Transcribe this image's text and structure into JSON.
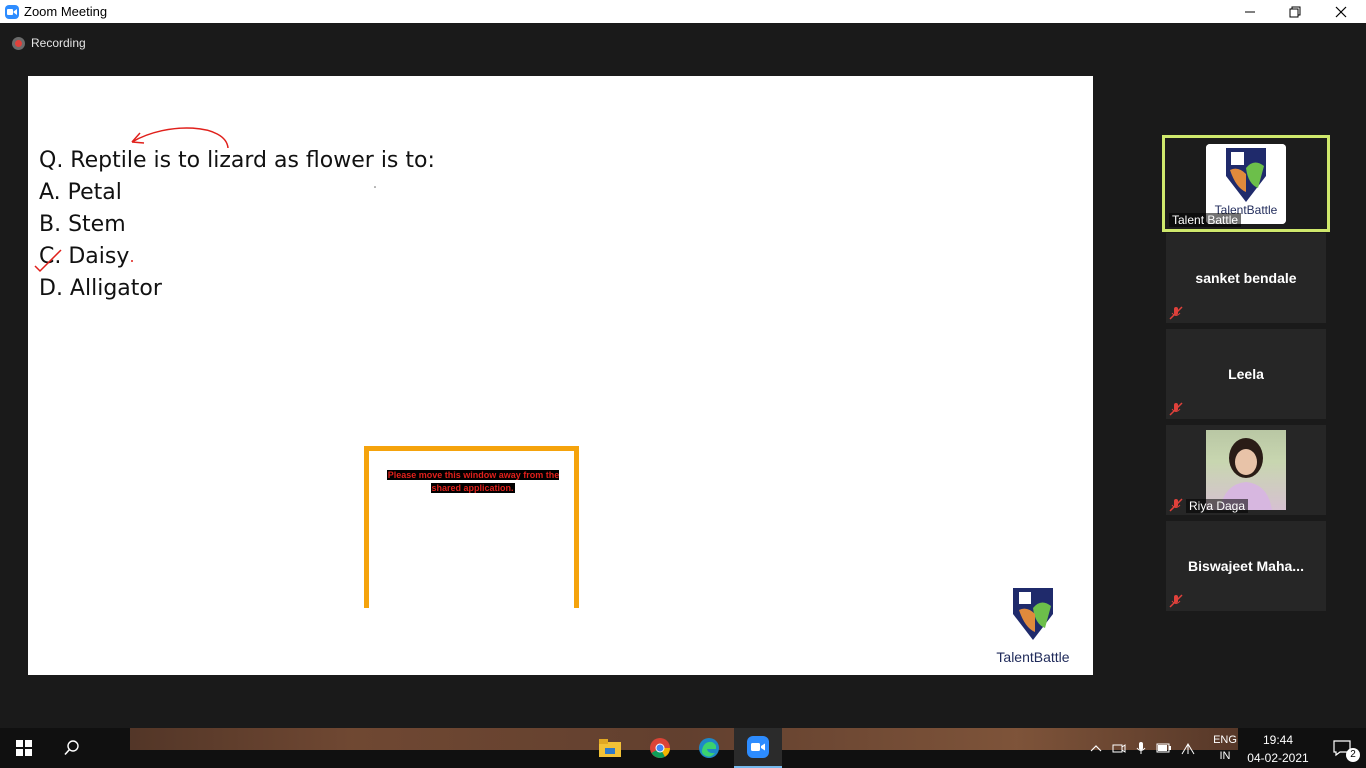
{
  "window": {
    "title": "Zoom Meeting"
  },
  "recording": {
    "label": "Recording"
  },
  "slide": {
    "question": "Q. Reptile is to lizard as flower is to:",
    "options": [
      "A. Petal",
      "B. Stem",
      "C. Daisy",
      "D. Alligator"
    ],
    "logo_text": "TalentBattle"
  },
  "popup": {
    "message": "Please move this window away from the shared application."
  },
  "participants": [
    {
      "name": "Talent Battle",
      "active": true
    },
    {
      "name": "sanket bendale",
      "muted": true
    },
    {
      "name": "Leela",
      "muted": true
    },
    {
      "name": "Riya Daga",
      "muted": true
    },
    {
      "name": "Biswajeet  Maha...",
      "muted": true
    }
  ],
  "taskbar": {
    "language": "ENG",
    "region": "IN",
    "time": "19:44",
    "date": "04-02-2021",
    "notification_count": "2"
  },
  "colors": {
    "accent": "#2d8cff",
    "active_border": "#cfe86c",
    "popup_border": "#f5a30c",
    "annotation": "#e0201b"
  }
}
